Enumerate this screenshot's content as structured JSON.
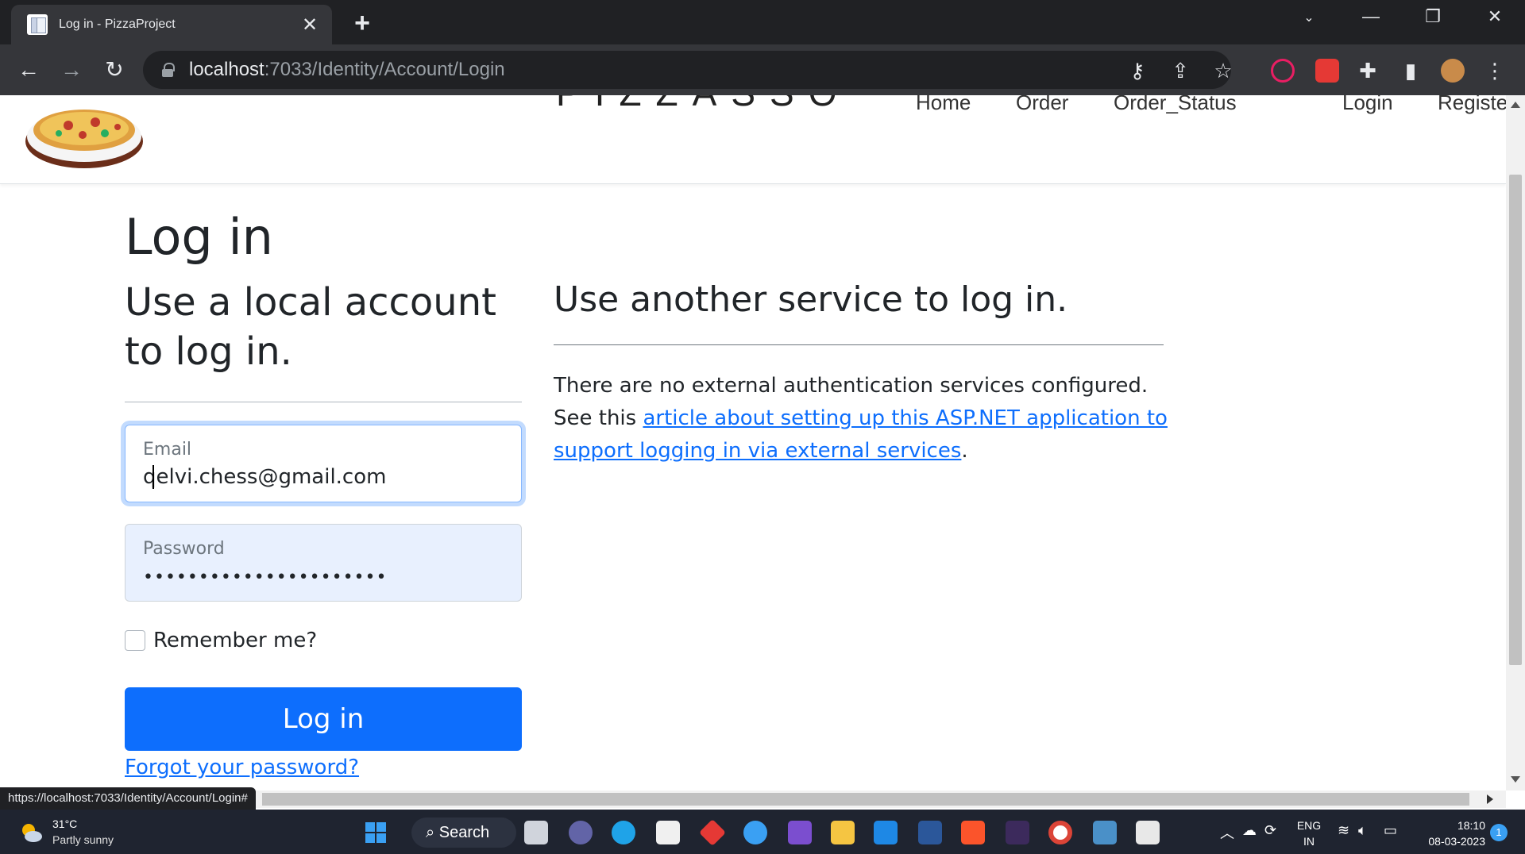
{
  "browser": {
    "tab_title": "Log in - PizzaProject",
    "tab_close": "✕",
    "new_tab": "+",
    "url_host": "localhost",
    "url_path": ":7033/Identity/Account/Login",
    "status_url": "https://localhost:7033/Identity/Account/Login#"
  },
  "site": {
    "brand": "PIZZASSO",
    "nav": {
      "home": "Home",
      "order": "Order",
      "order_status": "Order_Status",
      "login": "Login",
      "register": "Registe"
    }
  },
  "page": {
    "title": "Log in",
    "local_heading": "Use a local account to log in.",
    "external_heading": "Use another service to log in.",
    "external_text_before": "There are no external authentication services configured. See this ",
    "external_link": "article about setting up this ASP.NET application to support logging in via external services",
    "external_text_after": "."
  },
  "form": {
    "email_label": "Email",
    "email_value": "qelvi.chess@gmail.com",
    "password_label": "Password",
    "password_value": "••••••••••••••••••••••",
    "remember_label": "Remember me?",
    "remember_checked": false,
    "login_button": "Log in",
    "forgot_link": "Forgot your password?"
  },
  "taskbar": {
    "weather_temp": "31°C",
    "weather_desc": "Partly sunny",
    "search_label": "Search",
    "lang_top": "ENG",
    "lang_bottom": "IN",
    "time": "18:10",
    "date": "08-03-2023",
    "notification_count": "1"
  },
  "colors": {
    "primary": "#0d6efd",
    "link": "#0d6efd",
    "browser_dark": "#202124",
    "autofill": "#e8f0fe"
  }
}
